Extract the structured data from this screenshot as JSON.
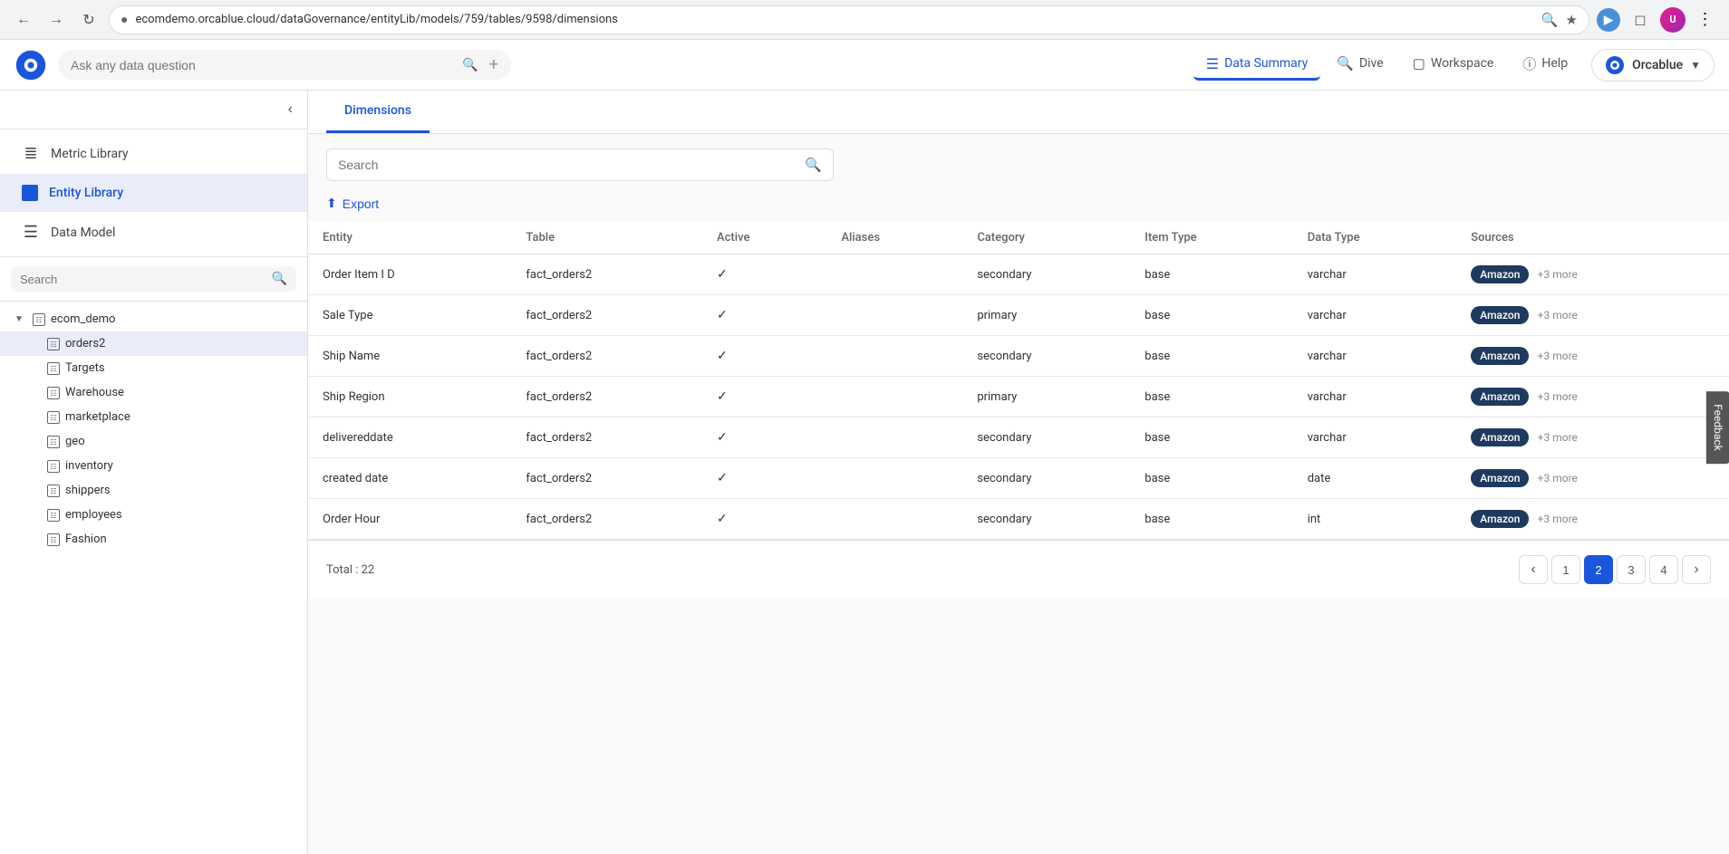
{
  "browser": {
    "url": "ecomdemo.orcablue.cloud/dataGovernance/entityLib/models/759/tables/9598/dimensions",
    "back_label": "←",
    "forward_label": "→",
    "reload_label": "↺"
  },
  "app_header": {
    "search_placeholder": "Ask any data question",
    "nav_items": [
      {
        "id": "data-summary",
        "label": "Data Summary",
        "active": true
      },
      {
        "id": "dive",
        "label": "Dive",
        "active": false
      },
      {
        "id": "workspace",
        "label": "Workspace",
        "active": false
      },
      {
        "id": "help",
        "label": "Help",
        "active": false
      }
    ],
    "brand_label": "Orcablue"
  },
  "sidebar": {
    "collapse_label": "‹",
    "nav_items": [
      {
        "id": "metric-library",
        "label": "Metric Library",
        "active": false
      },
      {
        "id": "entity-library",
        "label": "Entity Library",
        "active": true
      },
      {
        "id": "data-model",
        "label": "Data Model",
        "active": false
      }
    ],
    "search_placeholder": "Search",
    "tree": {
      "root": {
        "label": "ecom_demo",
        "expanded": true,
        "children": [
          {
            "id": "orders2",
            "label": "orders2",
            "selected": true
          },
          {
            "id": "targets",
            "label": "Targets"
          },
          {
            "id": "warehouse",
            "label": "Warehouse"
          },
          {
            "id": "marketplace",
            "label": "marketplace"
          },
          {
            "id": "geo",
            "label": "geo"
          },
          {
            "id": "inventory",
            "label": "inventory"
          },
          {
            "id": "shippers",
            "label": "shippers"
          },
          {
            "id": "employees",
            "label": "employees"
          },
          {
            "id": "fashion",
            "label": "Fashion"
          }
        ]
      }
    }
  },
  "content": {
    "tabs": [
      {
        "id": "dimensions",
        "label": "Dimensions",
        "active": true
      }
    ],
    "search_placeholder": "Search",
    "export_label": "Export",
    "table": {
      "columns": [
        "Entity",
        "Table",
        "Active",
        "Aliases",
        "Category",
        "Item Type",
        "Data Type",
        "Sources"
      ],
      "rows": [
        {
          "entity": "Order Item I D",
          "table": "fact_orders2",
          "active": true,
          "aliases": "",
          "category": "secondary",
          "item_type": "base",
          "data_type": "varchar",
          "source": "Amazon",
          "more": "+3 more"
        },
        {
          "entity": "Sale Type",
          "table": "fact_orders2",
          "active": true,
          "aliases": "",
          "category": "primary",
          "item_type": "base",
          "data_type": "varchar",
          "source": "Amazon",
          "more": "+3 more"
        },
        {
          "entity": "Ship Name",
          "table": "fact_orders2",
          "active": true,
          "aliases": "",
          "category": "secondary",
          "item_type": "base",
          "data_type": "varchar",
          "source": "Amazon",
          "more": "+3 more"
        },
        {
          "entity": "Ship Region",
          "table": "fact_orders2",
          "active": true,
          "aliases": "",
          "category": "primary",
          "item_type": "base",
          "data_type": "varchar",
          "source": "Amazon",
          "more": "+3 more"
        },
        {
          "entity": "delivereddate",
          "table": "fact_orders2",
          "active": true,
          "aliases": "",
          "category": "secondary",
          "item_type": "base",
          "data_type": "varchar",
          "source": "Amazon",
          "more": "+3 more"
        },
        {
          "entity": "created date",
          "table": "fact_orders2",
          "active": true,
          "aliases": "",
          "category": "secondary",
          "item_type": "base",
          "data_type": "date",
          "source": "Amazon",
          "more": "+3 more"
        },
        {
          "entity": "Order Hour",
          "table": "fact_orders2",
          "active": true,
          "aliases": "",
          "category": "secondary",
          "item_type": "base",
          "data_type": "int",
          "source": "Amazon",
          "more": "+3 more"
        }
      ]
    },
    "pagination": {
      "total_label": "Total : 22",
      "pages": [
        1,
        2,
        3,
        4
      ],
      "current_page": 2,
      "prev_label": "‹",
      "next_label": "›"
    }
  },
  "feedback": {
    "label": "Feedback"
  },
  "icons": {
    "search": "🔍",
    "metric_library": "≡",
    "entity_library": "▪",
    "data_model": "☰",
    "tree_node": "⊞",
    "checkmark": "✓",
    "export": "⬆",
    "data_summary": "≡",
    "dive": "🔍",
    "workspace": "⬡",
    "help": "?",
    "globe": "🌐"
  }
}
